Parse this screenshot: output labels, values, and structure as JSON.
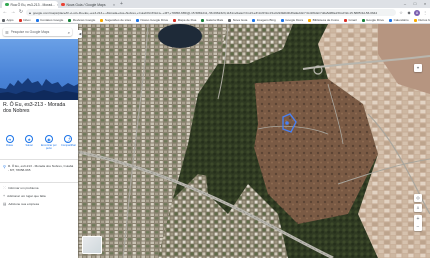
{
  "browser": {
    "tabs": [
      {
        "title": "Rua Ô Eu, es3-213 - Morad...",
        "active": true
      },
      {
        "title": "Nova Guia / Google Maps",
        "active": false
      }
    ],
    "address": "google.com/maps/place/R.+Luiz+Ro+Eu,+es3-213+-+Morada+dos+Nobres,+Cuiab%C3%A1+-+MT,+78058-665/@-15.5881211,-56.0662323,1181m/data=!3m1!1e3!4m5!3m4!1s0x939db0b36a9eb0c7:0x4b5d2c7d2a5d88a1!8m2!3d-15.5885!4d-56.0644",
    "bookmarks": [
      {
        "label": "Apps",
        "color": "#5f6368"
      },
      {
        "label": "Inbox",
        "color": "#d93025"
      },
      {
        "label": "Contatos Google",
        "color": "#1a73e8"
      },
      {
        "label": "Reviews Google",
        "color": "#188038"
      },
      {
        "label": "Sugestões de sites",
        "color": "#f9ab00"
      },
      {
        "label": "Nosso Google Drive",
        "color": "#1a73e8"
      },
      {
        "label": "Mapa de Rua",
        "color": "#d93025"
      },
      {
        "label": "Galeria Mais",
        "color": "#188038"
      },
      {
        "label": "Nova Guia",
        "color": "#5f6368"
      },
      {
        "label": "Imagens Bing",
        "color": "#1a73e8"
      },
      {
        "label": "Google Docs",
        "color": "#1a73e8"
      },
      {
        "label": "Biblioteca de Fotos",
        "color": "#f9ab00"
      },
      {
        "label": "Gmail",
        "color": "#d93025"
      },
      {
        "label": "Google Drive",
        "color": "#188038"
      },
      {
        "label": "Calendário",
        "color": "#1a73e8"
      },
      {
        "label": "Outros favoritos",
        "color": "#f9ab00"
      }
    ]
  },
  "panel": {
    "search_placeholder": "Pesquise no Google Maps",
    "place_title": "R. Ô Eu, es3-213 - Morada dos Nobres",
    "actions": [
      {
        "label": "Rotas",
        "icon": "directions-icon",
        "glyph": "➜"
      },
      {
        "label": "Salvar",
        "icon": "bookmark-icon",
        "glyph": "★"
      },
      {
        "label": "Encontrar por perto",
        "icon": "nearby-icon",
        "glyph": "◉"
      },
      {
        "label": "Compartilhar",
        "icon": "share-icon",
        "glyph": "⤴"
      }
    ],
    "address": "R. Ô Eu, es3-213 - Morada dos Nobres, Cuiabá - MT, 78058-665",
    "rows": [
      {
        "icon": "plus-code-icon",
        "glyph": "⁙",
        "text": "Informar um problema"
      },
      {
        "icon": "add-place-icon",
        "glyph": "+",
        "text": "Adicionar um lugar que falta"
      },
      {
        "icon": "business-icon",
        "glyph": "▤",
        "text": "Adicione sua empresa"
      }
    ]
  },
  "map": {
    "selection_color": "#4a80f0",
    "water_color": "#1e2a38"
  }
}
